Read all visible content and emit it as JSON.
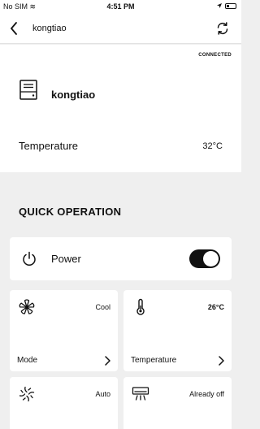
{
  "status_bar": {
    "carrier": "No SIM",
    "time": "4:51 PM",
    "battery_level": 0.3
  },
  "header": {
    "title": "kongtiao"
  },
  "device": {
    "connection_status": "CONNECTED",
    "name": "kongtiao",
    "temperature_label": "Temperature",
    "temperature_value": "32°C"
  },
  "quick_operation": {
    "title": "QUICK OPERATION",
    "power": {
      "label": "Power",
      "on": true
    },
    "tiles": {
      "mode": {
        "label": "Mode",
        "value": "Cool",
        "icon": "snowflake-icon"
      },
      "temperature": {
        "label": "Temperature",
        "value": "26°C",
        "icon": "thermometer-icon"
      },
      "fan": {
        "label": "",
        "value": "Auto",
        "icon": "fan-icon"
      },
      "swing": {
        "label": "",
        "value": "Already off",
        "icon": "air-conditioner-icon"
      }
    }
  },
  "colors": {
    "accent": "#111111",
    "background": "#efefef",
    "card": "#ffffff"
  }
}
